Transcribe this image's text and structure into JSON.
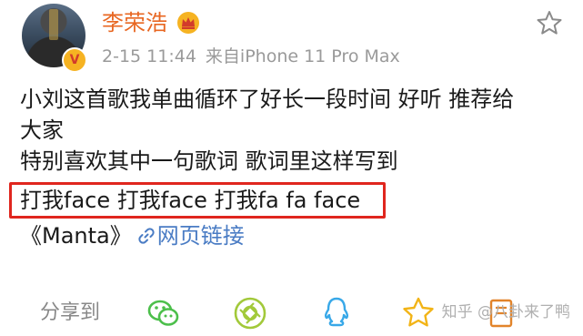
{
  "post": {
    "author": "李荣浩",
    "vip_badge": "V",
    "timestamp": "2-15 11:44",
    "source": "来自iPhone 11 Pro Max",
    "lines": [
      "小刘这首歌我单曲循环了好长一段时间 好听 推荐给",
      "大家",
      "特别喜欢其中一句歌词 歌词里这样写到"
    ],
    "highlighted_line": "打我face 打我face 打我fa fa face",
    "song_title": "《Manta》",
    "link_text": "网页链接"
  },
  "share": {
    "label": "分享到"
  },
  "watermark": "知乎 @八卦来了鸭",
  "colors": {
    "username": "#e86722",
    "link": "#4a7cc4",
    "highlight_border": "#e0261e",
    "meta": "#9a9a9a"
  },
  "icons": [
    "crown-icon",
    "star-icon",
    "link-icon",
    "wechat-icon",
    "moments-icon",
    "qq-icon",
    "qzone-icon",
    "note-icon"
  ]
}
